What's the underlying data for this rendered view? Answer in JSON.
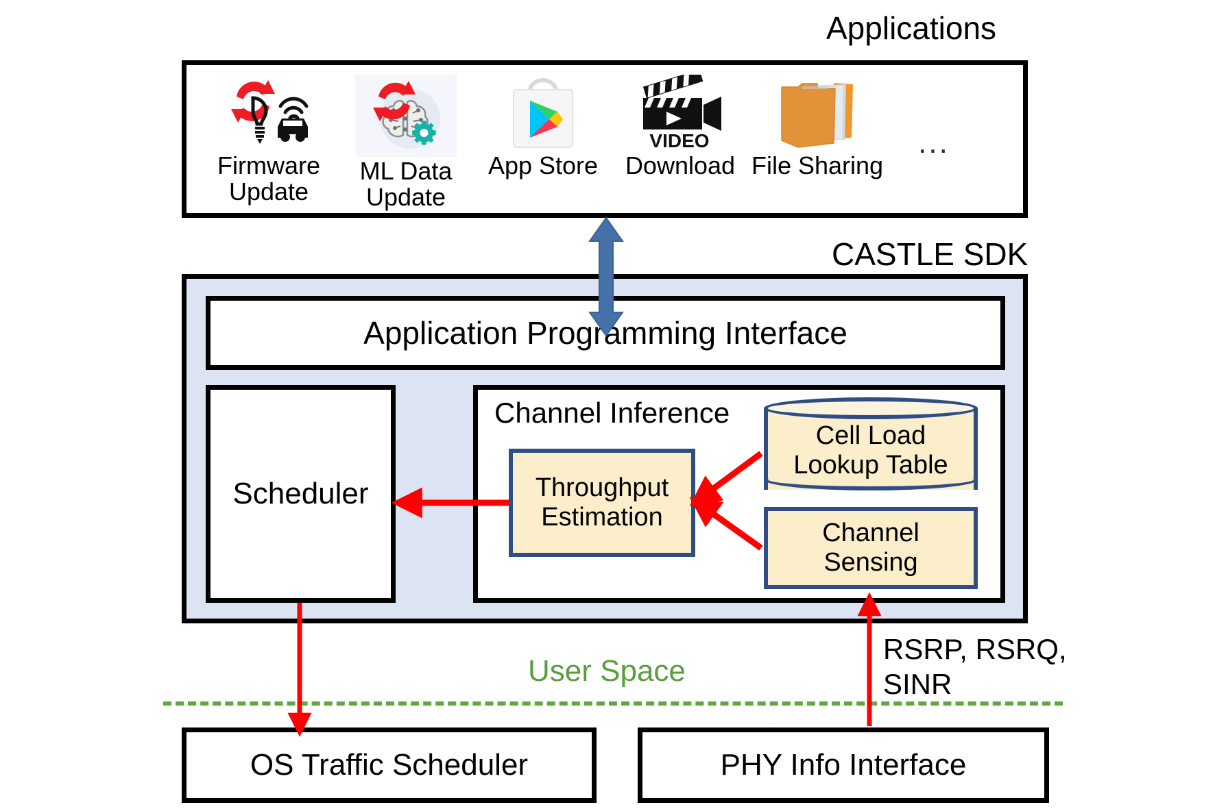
{
  "headings": {
    "applications": "Applications",
    "castle_sdk": "CASTLE SDK"
  },
  "applications": {
    "items": [
      {
        "label": "Firmware\nUpdate",
        "icon": "firmware-update-icon"
      },
      {
        "label": "ML Data\nUpdate",
        "icon": "ml-brain-gear-icon"
      },
      {
        "label": "App Store",
        "icon": "app-store-bag-icon"
      },
      {
        "label": "Download",
        "icon": "video-camera-icon"
      },
      {
        "label": "File Sharing",
        "icon": "folder-icon"
      }
    ],
    "ellipsis": "..."
  },
  "sdk": {
    "api_label": "Application Programming Interface",
    "scheduler_label": "Scheduler",
    "channel_inference_title": "Channel Inference",
    "throughput_label": "Throughput\nEstimation",
    "cell_load_label": "Cell Load\nLookup Table",
    "channel_sensing_label": "Channel\nSensing"
  },
  "divider": {
    "user_space_label": "User Space",
    "phy_metrics_label": "RSRP, RSRQ,\nSINR"
  },
  "kernel": {
    "os_traffic_scheduler": "OS Traffic Scheduler",
    "phy_info_interface": "PHY Info Interface"
  },
  "colors": {
    "sdk_fill": "#dce3f2",
    "process_fill": "#fceecb",
    "process_border": "#2e4e84",
    "arrow_red": "#ff0000",
    "arrow_blue": "#4472a8",
    "user_space_green": "#5a9e3d",
    "divider_green": "#5fa83f",
    "box_border": "#000000"
  }
}
